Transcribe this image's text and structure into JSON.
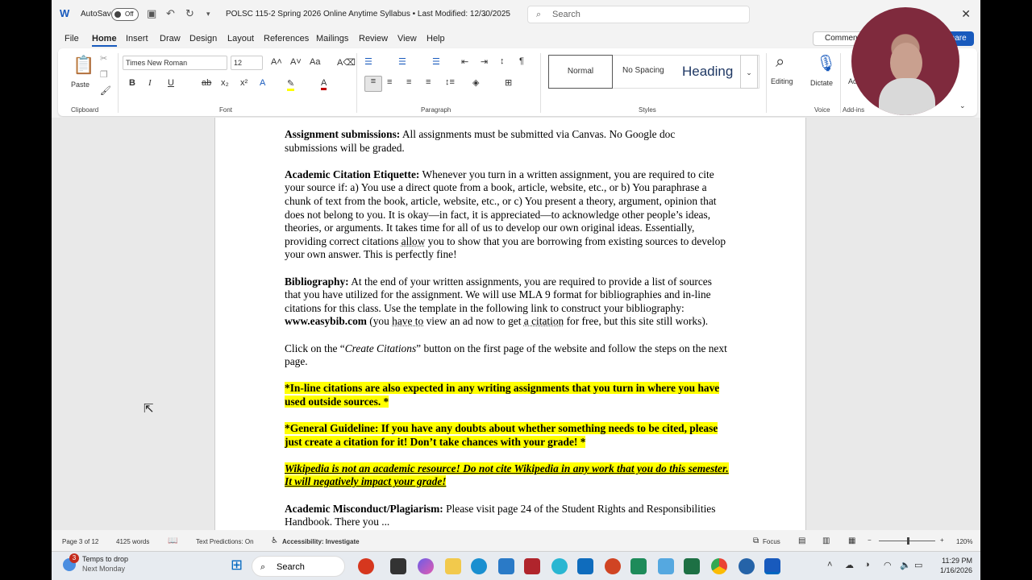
{
  "titlebar": {
    "autosave_label": "AutoSave",
    "autosave_state": "Off",
    "document_title": "POLSC 115-2 Spring 2026 Online Anytime Syllabus • Last Modified: 12/30/2025",
    "search_placeholder": "Search"
  },
  "menu": {
    "tabs": [
      "File",
      "Home",
      "Insert",
      "Draw",
      "Design",
      "Layout",
      "References",
      "Mailings",
      "Review",
      "View",
      "Help"
    ],
    "active_tab": "Home",
    "comments_label": "Comments",
    "share_label": "Share"
  },
  "ribbon": {
    "clipboard_label": "Clipboard",
    "paste_label": "Paste",
    "font_label": "Font",
    "font_name": "Times New Roman",
    "font_size": "12",
    "paragraph_label": "Paragraph",
    "styles_label": "Styles",
    "style_normal": "Normal",
    "style_no_spacing": "No Spacing",
    "style_heading": "Heading",
    "editing_label": "Editing",
    "dictate_label": "Dictate",
    "voice_label": "Voice",
    "addins_label": "Add-ins",
    "addins_short": "Ad"
  },
  "document": {
    "p1_bold": "Assignment submissions:",
    "p1_text": " All assignments must be submitted via Canvas. No Google doc submissions will be graded.",
    "p2_bold": "Academic Citation Etiquette:",
    "p2_text_a": " Whenever you turn in a written assignment, you are required to cite your source if: a) You use a direct quote from a book, article, website, etc., or b) You paraphrase a chunk of text from the book, article, website, etc., or c) You present a theory, argument, opinion that does not belong to you. It is okay—in fact, it is appreciated—to acknowledge other people’s ideas, theories, or arguments. It takes time for all of us to develop our own original ideas. Essentially, providing correct citations ",
    "p2_allow": "allow",
    "p2_text_b": " you to show that you are borrowing from existing sources to develop your own answer. This is perfectly fine!",
    "p3_bold": "Bibliography:",
    "p3_text_a": " At the end of your written assignments, you are required to provide a list of sources that you have utilized for the assignment. We will use MLA 9 format for bibliographies and in-line citations for this class. Use the template in the following link to construct your bibliography: ",
    "p3_link": "www.easybib.com",
    "p3_text_b": " (you ",
    "p3_have_to": "have to",
    "p3_text_c": " view an ad now to get ",
    "p3_a_citation": "a citation",
    "p3_text_d": " for free, but this site still works).",
    "p4_text_a": "Click on the “",
    "p4_italic": "Create Citations",
    "p4_text_b": "” button on the first page of the website and follow the steps on the next page.",
    "p5_highlight": "*In-line citations are also expected in any writing assignments that you turn in where you have used outside sources. *",
    "p6_highlight": "*General Guideline: If you have any doubts about whether something needs to be cited, please just create a citation for it! Don’t take chances with your grade! *",
    "p7_highlight": "Wikipedia is not an academic resource! Do not cite Wikipedia in any work that you do this semester. It will negatively impact your grade!",
    "p8_bold": "Academic Misconduct/Plagiarism:",
    "p8_text": " Please visit page 24 of the Student Rights and Responsibilities Handbook. There you ..."
  },
  "status": {
    "page": "Page 3 of 12",
    "words": "4125 words",
    "text_predictions": "Text Predictions: On",
    "accessibility": "Accessibility: Investigate",
    "focus": "Focus",
    "zoom": "120%"
  },
  "taskbar": {
    "weather_title": "Temps to drop",
    "weather_sub": "Next Monday",
    "weather_badge": "3",
    "search_label": "Search",
    "time": "11:29 PM",
    "date": "1/16/2026"
  },
  "colors": {
    "accent": "#185abd",
    "highlight": "#ffff00"
  }
}
